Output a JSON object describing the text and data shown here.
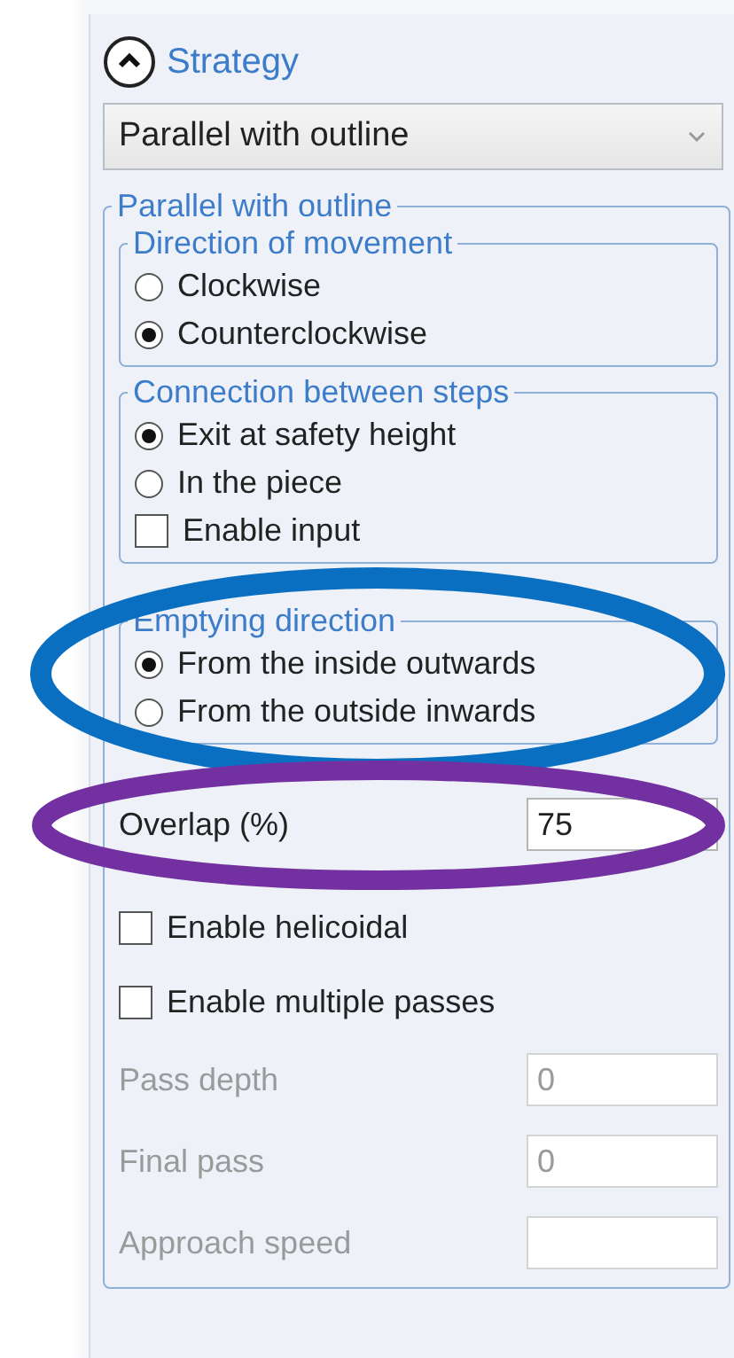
{
  "header": {
    "title": "Strategy",
    "expanded": true
  },
  "strategy_select": {
    "value": "Parallel with outline"
  },
  "group": {
    "title": "Parallel with outline",
    "subgroups": [
      {
        "title": "Direction of movement",
        "options": [
          {
            "kind": "radio",
            "label": "Clockwise",
            "selected": false
          },
          {
            "kind": "radio",
            "label": "Counterclockwise",
            "selected": true
          }
        ]
      },
      {
        "title": "Connection between steps",
        "options": [
          {
            "kind": "radio",
            "label": "Exit at safety height",
            "selected": true
          },
          {
            "kind": "radio",
            "label": "In the piece",
            "selected": false
          },
          {
            "kind": "checkbox",
            "label": "Enable input",
            "checked": false
          }
        ]
      },
      {
        "title": "Emptying direction",
        "options": [
          {
            "kind": "radio",
            "label": "From the inside outwards",
            "selected": true
          },
          {
            "kind": "radio",
            "label": "From the outside inwards",
            "selected": false
          }
        ]
      }
    ],
    "fields": [
      {
        "kind": "input",
        "label": "Overlap (%)",
        "value": "75",
        "disabled": false
      },
      {
        "kind": "checkbox",
        "label": "Enable helicoidal",
        "checked": false
      },
      {
        "kind": "checkbox",
        "label": "Enable multiple passes",
        "checked": false
      },
      {
        "kind": "input",
        "label": "Pass depth",
        "value": "0",
        "disabled": true
      },
      {
        "kind": "input",
        "label": "Final pass",
        "value": "0",
        "disabled": true
      },
      {
        "kind": "input",
        "label": "Approach speed",
        "disabled": true
      }
    ]
  },
  "annotations": [
    {
      "color": "#0b6fc1"
    },
    {
      "color": "#7330a0"
    }
  ]
}
